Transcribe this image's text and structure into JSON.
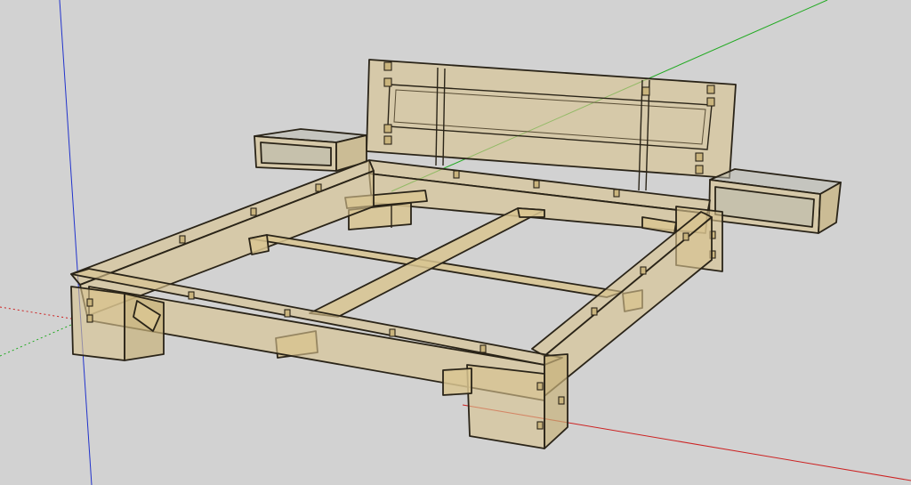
{
  "app": {
    "name": "",
    "mode": "3d-model-viewport"
  },
  "model": {
    "subject": "bed-frame-with-headboard-and-nightstands"
  },
  "axes": {
    "x_color": "#cc2222",
    "y_color": "#22aa22",
    "z_color": "#2233cc"
  },
  "colors": {
    "background": "#d2d2d2",
    "wood": "#d8c48f",
    "outline": "#2a2418",
    "glass": "#b9b9ae"
  }
}
